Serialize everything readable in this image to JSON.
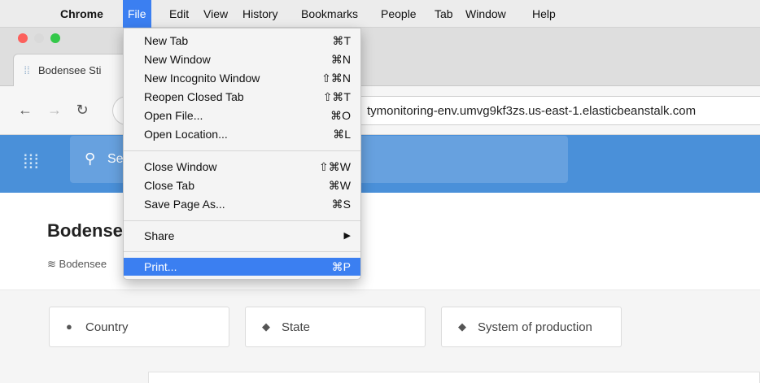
{
  "menubar": {
    "apple_icon": "apple-logo-icon",
    "items": [
      {
        "label": "Chrome"
      },
      {
        "label": "File"
      },
      {
        "label": "Edit"
      },
      {
        "label": "View"
      },
      {
        "label": "History"
      },
      {
        "label": "Bookmarks"
      },
      {
        "label": "People"
      },
      {
        "label": "Tab"
      },
      {
        "label": "Window"
      },
      {
        "label": "Help"
      }
    ],
    "active": "File"
  },
  "window": {
    "traffic_lights": {
      "close": "#fc605c",
      "minimize": "#d9d9d9",
      "zoom": "#34c84a"
    },
    "tab": {
      "title": "Bodensee Sti"
    },
    "address_bar": {
      "url": "tymonitoring-env.umvg9kf3zs.us-east-1.elasticbeanstalk.com"
    }
  },
  "file_menu": {
    "groups": [
      [
        {
          "label": "New Tab",
          "shortcut": "⌘T"
        },
        {
          "label": "New Window",
          "shortcut": "⌘N"
        },
        {
          "label": "New Incognito Window",
          "shortcut": "⇧⌘N"
        },
        {
          "label": "Reopen Closed Tab",
          "shortcut": "⇧⌘T"
        },
        {
          "label": "Open File...",
          "shortcut": "⌘O"
        },
        {
          "label": "Open Location...",
          "shortcut": "⌘L"
        }
      ],
      [
        {
          "label": "Close Window",
          "shortcut": "⇧⌘W"
        },
        {
          "label": "Close Tab",
          "shortcut": "⌘W"
        },
        {
          "label": "Save Page As...",
          "shortcut": "⌘S"
        }
      ],
      [
        {
          "label": "Share",
          "shortcut": "▶"
        }
      ],
      [
        {
          "label": "Print...",
          "shortcut": "⌘P",
          "highlighted": true
        }
      ]
    ]
  },
  "page": {
    "search_placeholder": "Se",
    "title": "Bodense",
    "breadcrumb": "Bodensee",
    "filters": [
      {
        "label": "Country",
        "icon": "map-marker-icon"
      },
      {
        "label": "State",
        "icon": "tag-icon"
      },
      {
        "label": "System of production",
        "icon": "tag-icon"
      }
    ]
  },
  "colors": {
    "accent": "#4a90d9",
    "menu_highlight": "#3b7ff1"
  }
}
